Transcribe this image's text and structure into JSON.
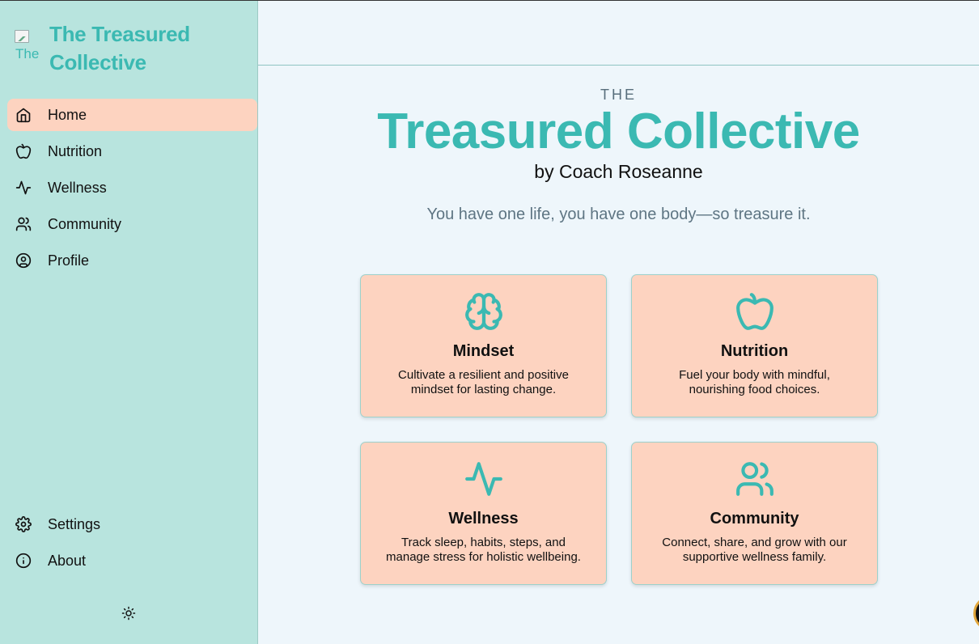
{
  "brand": {
    "logo_alt": "The",
    "title": "The Treasured Collective"
  },
  "sidebar": {
    "items": [
      {
        "label": "Home",
        "icon": "home-icon",
        "active": true
      },
      {
        "label": "Nutrition",
        "icon": "apple-icon",
        "active": false
      },
      {
        "label": "Wellness",
        "icon": "activity-icon",
        "active": false
      },
      {
        "label": "Community",
        "icon": "users-icon",
        "active": false
      },
      {
        "label": "Profile",
        "icon": "user-circle-icon",
        "active": false
      }
    ],
    "bottom_items": [
      {
        "label": "Settings",
        "icon": "gear-icon"
      },
      {
        "label": "About",
        "icon": "info-icon"
      }
    ],
    "theme_toggle_icon": "sun-icon"
  },
  "hero": {
    "kicker": "THE",
    "title": "Treasured Collective",
    "byline": "by Coach Roseanne",
    "tagline": "You have one life, you have one body—so treasure it."
  },
  "cards": [
    {
      "title": "Mindset",
      "desc": "Cultivate a resilient and positive mindset for lasting change.",
      "icon": "brain-icon"
    },
    {
      "title": "Nutrition",
      "desc": "Fuel your body with mindful, nourishing food choices.",
      "icon": "apple-icon"
    },
    {
      "title": "Wellness",
      "desc": "Track sleep, habits, steps, and manage stress for holistic wellbeing.",
      "icon": "activity-icon"
    },
    {
      "title": "Community",
      "desc": "Connect, share, and grow with our supportive wellness family.",
      "icon": "users-icon"
    }
  ],
  "colors": {
    "accent": "#3bb9b2",
    "sidebar_bg": "#b8e4de",
    "active_bg": "#fdd3c0",
    "card_bg": "#fdd3c0",
    "page_bg": "#eef6fb"
  }
}
